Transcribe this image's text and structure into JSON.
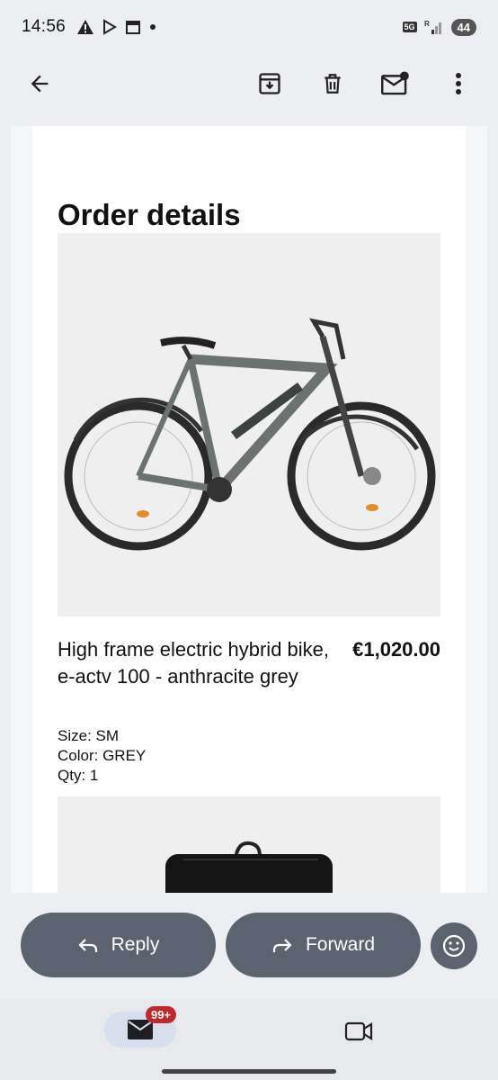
{
  "status_bar": {
    "time": "14:56",
    "network": "5G",
    "roaming": "R",
    "battery": "44"
  },
  "app_bar": {
    "icons": [
      "back-arrow-icon",
      "archive-icon",
      "delete-icon",
      "mark-unread-icon",
      "more-vert-icon"
    ]
  },
  "email": {
    "title": "Order details",
    "item": {
      "name": "High frame electric hybrid bike, e-actv 100 - anthracite grey",
      "price": "€1,020.00",
      "size": "Size: SM",
      "color": "Color: GREY",
      "qty": "Qty: 1"
    }
  },
  "actions": {
    "reply_label": "Reply",
    "forward_label": "Forward"
  },
  "bottom_nav": {
    "mail_badge": "99+"
  },
  "colors": {
    "pill": "#5b6270",
    "badge": "#c0282d",
    "background": "#eceef1"
  }
}
